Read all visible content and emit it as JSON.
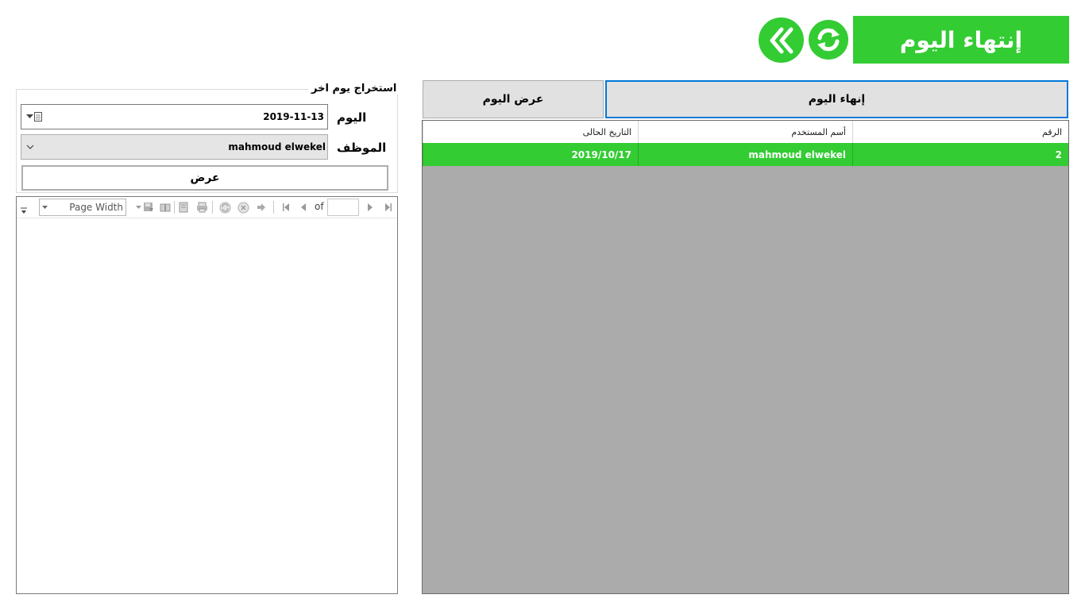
{
  "header": {
    "title": "إنتهاء اليوم",
    "refresh_icon": "refresh-icon",
    "back_icon": "double-chevron-left-icon"
  },
  "right_panel": {
    "end_day_button": "إنهاء اليوم",
    "show_day_button": "عرض اليوم",
    "grid": {
      "columns": [
        "الرقم",
        "أسم المستخدم",
        "التاريخ الحالى"
      ],
      "rows": [
        {
          "number": "2",
          "username": "mahmoud elwekel",
          "current_date": "2019/10/17"
        }
      ]
    }
  },
  "left_panel": {
    "group_title": "استخراج يوم اخر",
    "day_label": "اليوم",
    "day_value": "2019-11-13",
    "employee_label": "الموظف",
    "employee_value": "mahmoud elwekel",
    "show_button": "عرض",
    "report_viewer": {
      "zoom": "Page Width",
      "page_of_label": "of"
    }
  },
  "colors": {
    "accent_green": "#33cc33",
    "grid_background": "#ababab",
    "focus_blue": "#0078d7"
  }
}
